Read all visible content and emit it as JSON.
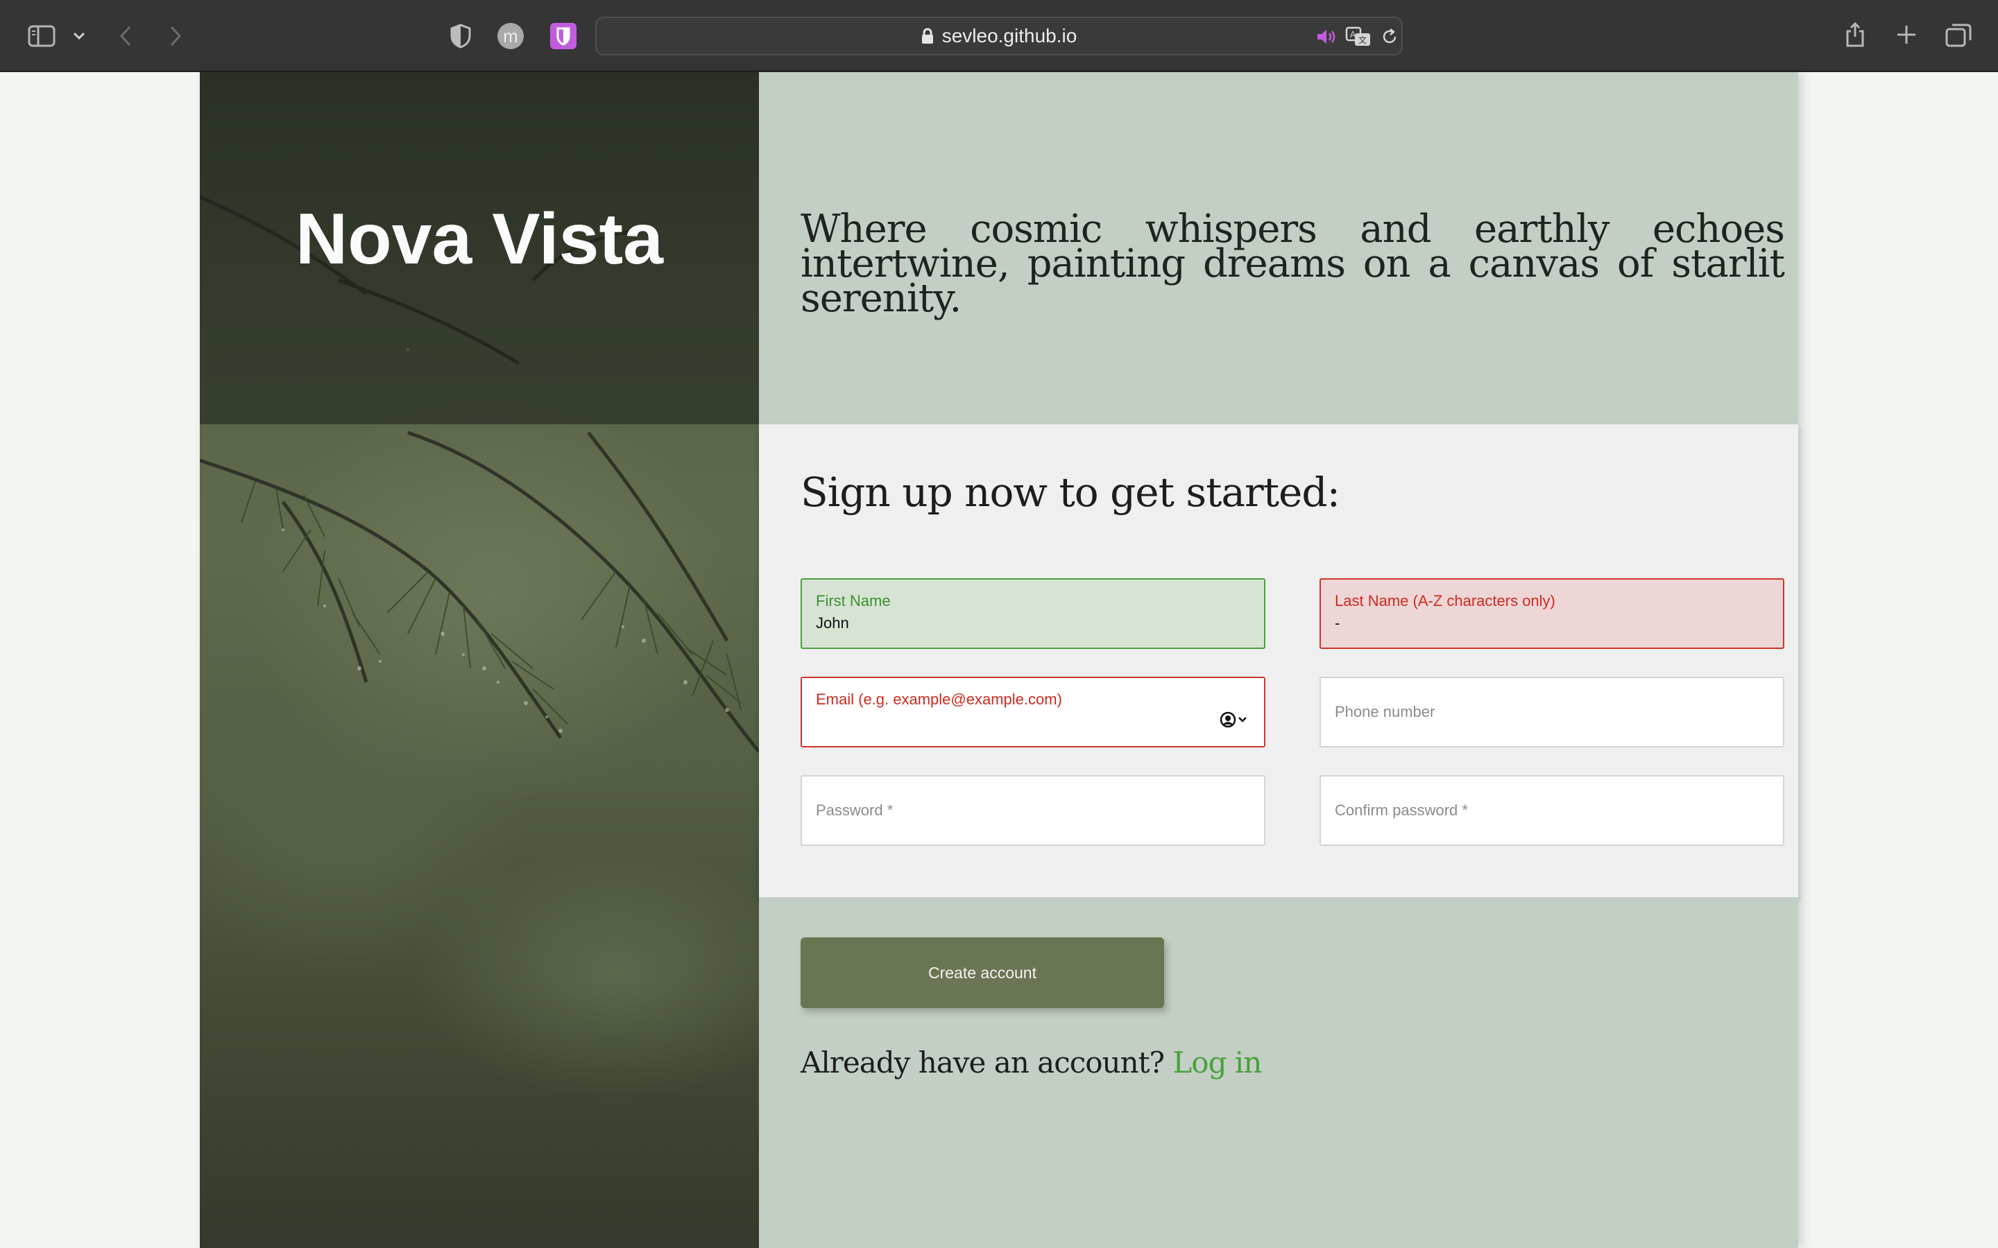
{
  "browser": {
    "url_host": "sevleo.github.io",
    "extension_letter": "m",
    "colors": {
      "accent_extension": "#c15ddc"
    }
  },
  "brand": {
    "name": "Nova Vista"
  },
  "hero": {
    "tagline": "Where cosmic whispers and earthly echoes intertwine, painting dreams on a canvas of starlit serenity."
  },
  "form": {
    "title": "Sign up now to get started:",
    "first_name": {
      "label": "First Name",
      "value": "John",
      "state": "valid"
    },
    "last_name": {
      "label": "Last Name (A-Z characters only)",
      "value": "-",
      "state": "invalid"
    },
    "email": {
      "label": "Email (e.g. example@example.com)",
      "value": "",
      "state": "invalid"
    },
    "phone": {
      "placeholder": "Phone number"
    },
    "password": {
      "placeholder": "Password *"
    },
    "confirm_password": {
      "placeholder": "Confirm password *"
    }
  },
  "actions": {
    "create_account": "Create account",
    "already_text": "Already have an account?",
    "login_link": "Log in"
  },
  "icons": [
    "sidebar-icon",
    "chevron-down-icon",
    "back-icon",
    "forward-icon",
    "privacy-shield-icon",
    "extension-m-icon",
    "bitwarden-icon",
    "lock-icon",
    "audio-icon",
    "translate-icon",
    "reload-icon",
    "share-icon",
    "new-tab-icon",
    "tab-overview-icon",
    "contact-autofill-icon"
  ],
  "colors": {
    "valid": "#4aa03c",
    "invalid": "#d0342a",
    "button": "#6a7553",
    "panel": "#c3cfc4"
  }
}
